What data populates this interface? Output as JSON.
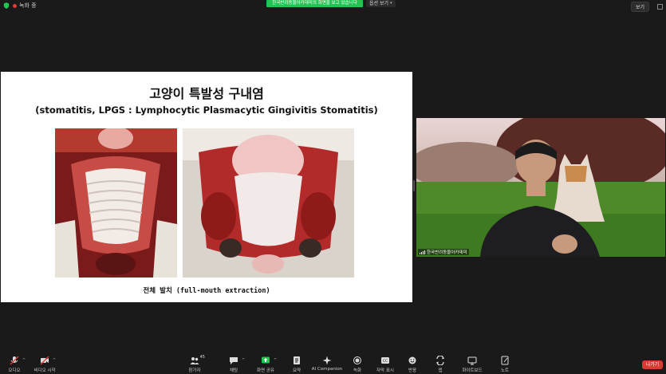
{
  "top": {
    "recording": "녹화 중",
    "share_banner": "한국반려동물아카데미의 화면을 보고 있습니다",
    "view_options": "옵션 보기",
    "view_button": "보기"
  },
  "slide": {
    "title": "고양이 특발성 구내염",
    "subtitle": "(stomatitis, LPGS : Lymphocytic Plasmacytic Gingivitis Stomatitis)",
    "caption": "전체 발치 (full-mouth extraction)"
  },
  "video": {
    "name": "한국반려동물아카데미"
  },
  "toolbar": {
    "items": [
      {
        "label": "오디오",
        "icon": "microphone-icon"
      },
      {
        "label": "비디오 시작",
        "icon": "video-camera-icon"
      },
      {
        "label": "참가자",
        "icon": "participants-icon",
        "count": "45"
      },
      {
        "label": "채팅",
        "icon": "chat-icon"
      },
      {
        "label": "화면 공유",
        "icon": "share-screen-icon"
      },
      {
        "label": "요약",
        "icon": "summary-icon"
      },
      {
        "label": "AI Companion",
        "icon": "ai-companion-icon"
      },
      {
        "label": "녹화",
        "icon": "record-icon"
      },
      {
        "label": "자막 표시",
        "icon": "captions-icon"
      },
      {
        "label": "반응",
        "icon": "reactions-icon"
      },
      {
        "label": "앱",
        "icon": "apps-icon"
      },
      {
        "label": "화이트보드",
        "icon": "whiteboard-icon"
      },
      {
        "label": "노트",
        "icon": "notes-icon"
      }
    ],
    "leave": "나가기"
  },
  "colors": {
    "background": "#1a1a1a",
    "share_banner": "#23c552",
    "leave_button": "#d93a32"
  }
}
